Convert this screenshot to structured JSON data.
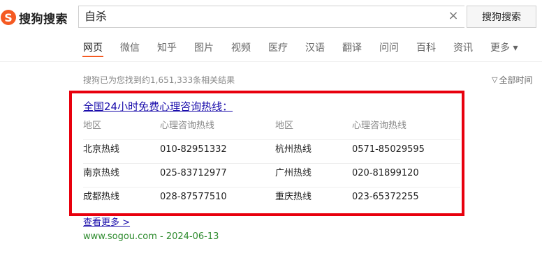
{
  "logo": {
    "mark": "S",
    "text": "搜狗搜索"
  },
  "search": {
    "query": "自杀",
    "clear_icon": "×",
    "button_label": "搜狗搜索"
  },
  "tabs": [
    {
      "label": "网页"
    },
    {
      "label": "微信"
    },
    {
      "label": "知乎"
    },
    {
      "label": "图片"
    },
    {
      "label": "视频"
    },
    {
      "label": "医疗"
    },
    {
      "label": "汉语"
    },
    {
      "label": "翻译"
    },
    {
      "label": "问问"
    },
    {
      "label": "百科"
    },
    {
      "label": "资讯"
    },
    {
      "label": "更多 ▾"
    }
  ],
  "results_meta": {
    "count_text": "搜狗已为您找到约1,651,333条相关结果",
    "time_filter": "全部时间",
    "filter_icon": "▽"
  },
  "result": {
    "title": "全国24小时免费心理咨询热线：",
    "table": {
      "headers": [
        "地区",
        "心理咨询热线",
        "地区",
        "心理咨询热线"
      ],
      "rows": [
        [
          "北京热线",
          "010-82951332",
          "杭州热线",
          "0571-85029595"
        ],
        [
          "南京热线",
          "025-83712977",
          "广州热线",
          "020-81899120"
        ],
        [
          "成都热线",
          "028-87577510",
          "重庆热线",
          "023-65372255"
        ]
      ]
    },
    "see_more": "查看更多 >",
    "source": "www.sogou.com - 2024-06-13"
  },
  "colors": {
    "accent": "#f55a22",
    "link": "#1a0dab",
    "highlight": "#e8000d",
    "url": "#2e8b2e"
  }
}
